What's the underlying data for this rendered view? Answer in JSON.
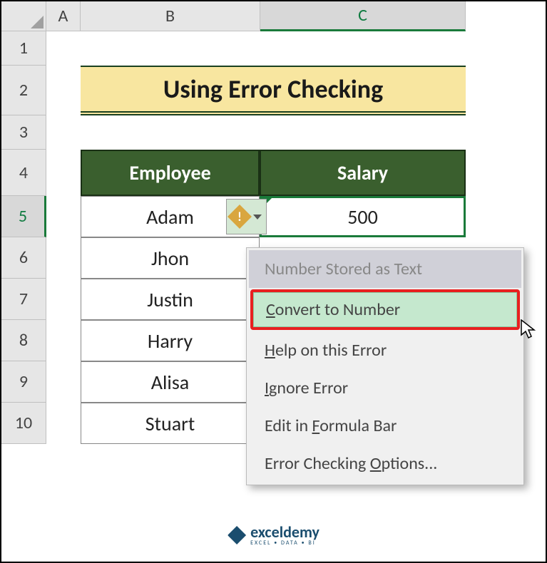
{
  "columns": {
    "A": "A",
    "B": "B",
    "C": "C"
  },
  "rows": {
    "r1": "1",
    "r2": "2",
    "r3": "3",
    "r4": "4",
    "r5": "5",
    "r6": "6",
    "r7": "7",
    "r8": "8",
    "r9": "9",
    "r10": "10"
  },
  "title": "Using Error Checking",
  "headers": {
    "employee": "Employee",
    "salary": "Salary"
  },
  "table": {
    "employees": [
      "Adam",
      "Jhon",
      "Justin",
      "Harry",
      "Alisa",
      "Stuart"
    ],
    "salaries": [
      "500",
      "",
      "",
      "",
      "",
      ""
    ]
  },
  "error_indicator": {
    "symbol": "!"
  },
  "menu": {
    "title": "Number Stored as Text",
    "convert": "Convert to Number",
    "help": "Help on this Error",
    "ignore": "Ignore Error",
    "edit": "Edit in Formula Bar",
    "options": "Error Checking Options..."
  },
  "watermark": {
    "brand": "exceldemy",
    "tagline": "EXCEL • DATA • BI"
  },
  "chart_data": {
    "type": "table",
    "title": "Using Error Checking",
    "columns": [
      "Employee",
      "Salary"
    ],
    "rows": [
      [
        "Adam",
        "500"
      ],
      [
        "Jhon",
        ""
      ],
      [
        "Justin",
        ""
      ],
      [
        "Harry",
        ""
      ],
      [
        "Alisa",
        ""
      ],
      [
        "Stuart",
        ""
      ]
    ]
  }
}
